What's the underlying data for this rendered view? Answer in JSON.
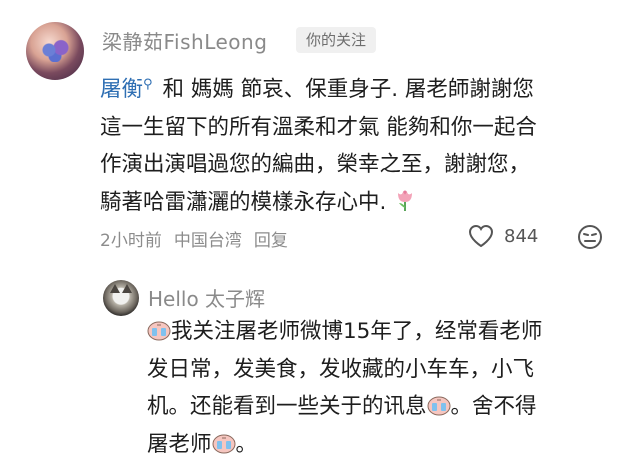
{
  "comment1": {
    "author": "梁静茹FishLeong",
    "badge": "你的关注",
    "mention": "屠衡",
    "mention_icon": "search-link-icon",
    "lines": [
      "和 媽媽 節哀、保重身子. 屠老師謝謝您",
      "這一生留下的所有溫柔和才氣 能夠和你一起合",
      "作演出演唱過您的編曲，榮幸之至，謝謝您，",
      "騎著哈雷瀟灑的模樣永存心中."
    ],
    "emoji": "tulip-icon",
    "time": "2小时前",
    "location": "中国台湾",
    "reply_label": "回复",
    "like_count": "844"
  },
  "comment2": {
    "author": "Hello 太子辉",
    "segments": [
      "我关注屠老师微博15年了，经常看老师",
      "发日常，发美食，发收藏的小车车，小飞",
      "机。还能看到一些关于的讯息",
      "。舍不得",
      "屠老师",
      "。"
    ],
    "emoji": "crying-face-icon"
  },
  "colors": {
    "mention": "#2f6fb3",
    "meta_gray": "#8c8c8c",
    "badge_bg": "#f0f0f0"
  }
}
